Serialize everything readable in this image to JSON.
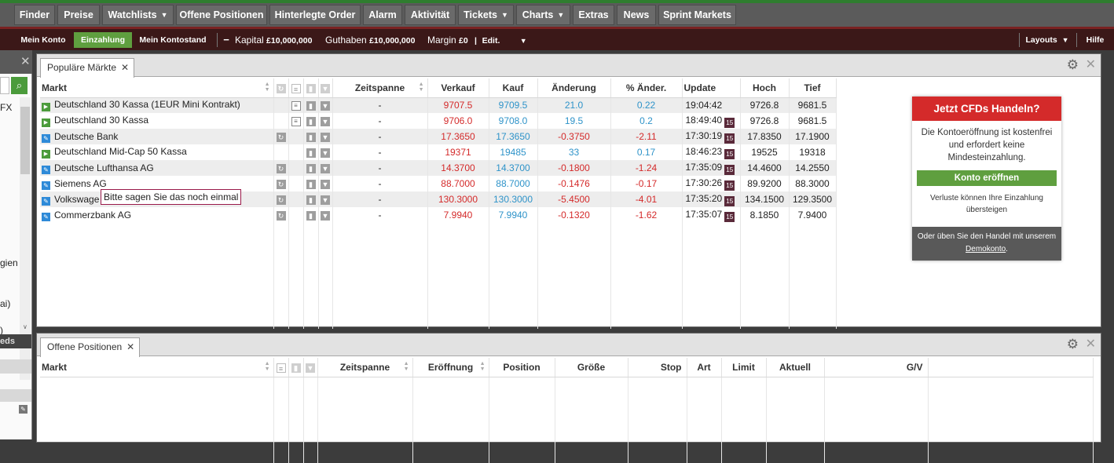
{
  "nav": {
    "items": [
      {
        "label": "Finder",
        "caret": false
      },
      {
        "label": "Preise",
        "caret": false
      },
      {
        "label": "Watchlists",
        "caret": true
      },
      {
        "label": "Offene Positionen",
        "caret": false
      },
      {
        "label": "Hinterlegte Order",
        "caret": false
      },
      {
        "label": "Alarm",
        "caret": false
      },
      {
        "label": "Aktivität",
        "caret": false
      },
      {
        "label": "Tickets",
        "caret": true
      },
      {
        "label": "Charts",
        "caret": true
      },
      {
        "label": "Extras",
        "caret": false
      },
      {
        "label": "News",
        "caret": false
      },
      {
        "label": "Sprint Markets",
        "caret": false
      }
    ]
  },
  "account": {
    "mein_konto": "Mein Konto",
    "einzahlung": "Einzahlung",
    "kontostand": "Mein Kontostand",
    "kapital_label": "Kapital",
    "kapital_value": "£10,000,000",
    "guthaben_label": "Guthaben",
    "guthaben_value": "£10,000,000",
    "margin_label": "Margin",
    "margin_value": "£0",
    "edit_label": "Edit.",
    "layouts": "Layouts",
    "hilfe": "Hilfe"
  },
  "left_panel": {
    "fragments": [
      "FX",
      "gien",
      "ai)",
      ")",
      "eds"
    ]
  },
  "markets_panel": {
    "tab_label": "Populäre Märkte",
    "columns": {
      "markt": "Markt",
      "zeitspanne": "Zeitspanne",
      "verkauf": "Verkauf",
      "kauf": "Kauf",
      "aenderung": "Änderung",
      "pct": "% Änder.",
      "update": "Update",
      "hoch": "Hoch",
      "tief": "Tief"
    },
    "rows": [
      {
        "icon": "play-icon",
        "name": "Deutschland 30 Kassa (1EUR Mini Kontrakt)",
        "refresh": false,
        "doc": true,
        "zeitspanne": "-",
        "verkauf": "9707.5",
        "kauf": "9709.5",
        "aenderung": "21.0",
        "pct": "0.22",
        "direction": "up",
        "update": "19:04:42",
        "badge": "",
        "hoch": "9726.8",
        "tief": "9681.5"
      },
      {
        "icon": "play-icon",
        "name": "Deutschland 30 Kassa",
        "refresh": false,
        "doc": true,
        "zeitspanne": "-",
        "verkauf": "9706.0",
        "kauf": "9708.0",
        "aenderung": "19.5",
        "pct": "0.2",
        "direction": "up",
        "update": "18:49:40",
        "badge": "15",
        "hoch": "9726.8",
        "tief": "9681.5"
      },
      {
        "icon": "pencil-icon",
        "name": "Deutsche Bank",
        "refresh": true,
        "doc": false,
        "zeitspanne": "-",
        "verkauf": "17.3650",
        "kauf": "17.3650",
        "aenderung": "-0.3750",
        "pct": "-2.11",
        "direction": "down",
        "update": "17:30:19",
        "badge": "15",
        "hoch": "17.8350",
        "tief": "17.1900"
      },
      {
        "icon": "play-icon",
        "name": "Deutschland Mid-Cap 50 Kassa",
        "refresh": false,
        "doc": false,
        "zeitspanne": "-",
        "verkauf": "19371",
        "kauf": "19485",
        "aenderung": "33",
        "pct": "0.17",
        "direction": "up",
        "update": "18:46:23",
        "badge": "15",
        "hoch": "19525",
        "tief": "19318"
      },
      {
        "icon": "pencil-icon",
        "name": "Deutsche Lufthansa AG",
        "refresh": true,
        "doc": false,
        "zeitspanne": "-",
        "verkauf": "14.3700",
        "kauf": "14.3700",
        "aenderung": "-0.1800",
        "pct": "-1.24",
        "direction": "down",
        "update": "17:35:09",
        "badge": "15",
        "hoch": "14.4600",
        "tief": "14.2550"
      },
      {
        "icon": "pencil-icon",
        "name": "Siemens AG",
        "refresh": true,
        "doc": false,
        "zeitspanne": "-",
        "verkauf": "88.7000",
        "kauf": "88.7000",
        "aenderung": "-0.1476",
        "pct": "-0.17",
        "direction": "down",
        "update": "17:30:26",
        "badge": "15",
        "hoch": "89.9200",
        "tief": "88.3000"
      },
      {
        "icon": "pencil-icon",
        "name": "Volkswage",
        "refresh": true,
        "doc": false,
        "zeitspanne": "-",
        "verkauf": "130.3000",
        "kauf": "130.3000",
        "aenderung": "-5.4500",
        "pct": "-4.01",
        "direction": "down",
        "update": "17:35:20",
        "badge": "15",
        "hoch": "134.1500",
        "tief": "129.3500"
      },
      {
        "icon": "pencil-icon",
        "name": "Commerzbank AG",
        "refresh": true,
        "doc": false,
        "zeitspanne": "-",
        "verkauf": "7.9940",
        "kauf": "7.9940",
        "aenderung": "-0.1320",
        "pct": "-1.62",
        "direction": "down",
        "update": "17:35:07",
        "badge": "15",
        "hoch": "8.1850",
        "tief": "7.9400"
      }
    ],
    "tooltip": "Bitte sagen Sie das noch einmal"
  },
  "promo": {
    "title": "Jetzt CFDs Handeln?",
    "body": "Die Kontoeröffnung ist kostenfrei und erfordert keine Mindesteinzahlung.",
    "button": "Konto eröffnen",
    "note": "Verluste können Ihre Einzahlung übersteigen",
    "footer_text": "Oder üben Sie den Handel mit unserem",
    "footer_link": "Demokonto",
    "footer_end": "."
  },
  "positions_panel": {
    "tab_label": "Offene Positionen",
    "columns": {
      "markt": "Markt",
      "zeitspanne": "Zeitspanne",
      "eroeffnung": "Eröffnung",
      "position": "Position",
      "groesse": "Größe",
      "stop": "Stop",
      "art": "Art",
      "limit": "Limit",
      "aktuell": "Aktuell",
      "gv": "G/V"
    }
  },
  "colors": {
    "up": "#2e93c9",
    "down": "#d42a2a",
    "brand_green": "#5f9f3f",
    "promo_red": "#d42a2a"
  }
}
